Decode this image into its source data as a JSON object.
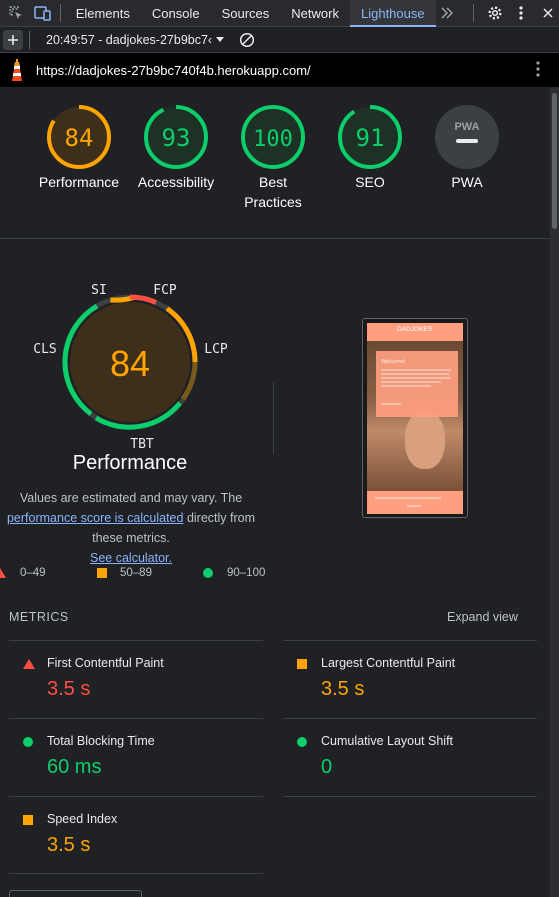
{
  "devtools": {
    "tabs": [
      {
        "label": "Elements",
        "active": false
      },
      {
        "label": "Console",
        "active": false
      },
      {
        "label": "Sources",
        "active": false
      },
      {
        "label": "Network",
        "active": false
      },
      {
        "label": "Lighthouse",
        "active": true
      }
    ],
    "more_tabs_icon": "chevron-double-right-icon",
    "settings_icon": "gear-icon",
    "menu_icon": "vertical-dots-icon",
    "report_selector": "20:49:57 - dadjokes-27b9bc7‹",
    "url": "https://dadjokes-27b9bc740f4b.herokuapp.com/"
  },
  "gauges": [
    {
      "label": "Performance",
      "score": "84",
      "value": 84,
      "color": "#ffa400"
    },
    {
      "label": "Accessibility",
      "score": "93",
      "value": 93,
      "color": "#0cce6b"
    },
    {
      "label": "Best Practices",
      "score": "100",
      "value": 100,
      "color": "#0cce6b"
    },
    {
      "label": "SEO",
      "score": "91",
      "value": 91,
      "color": "#0cce6b"
    },
    {
      "label": "PWA",
      "score": "PWA",
      "color": "#9aa0a6"
    }
  ],
  "performance": {
    "score": "84",
    "title": "Performance",
    "segments": {
      "si": "SI",
      "fcp": "FCP",
      "lcp": "LCP",
      "tbt": "TBT",
      "cls": "CLS"
    },
    "desc_before": "Values are estimated and may vary. The ",
    "desc_link": "performance score is calculated",
    "desc_middle": " directly from these metrics. ",
    "desc_link2": "See calculator."
  },
  "legend": [
    {
      "range": "0–49",
      "color": "#ff4e42",
      "shape": "triangle"
    },
    {
      "range": "50–89",
      "color": "#ffa400",
      "shape": "square"
    },
    {
      "range": "90–100",
      "color": "#0cce6b",
      "shape": "circle"
    }
  ],
  "screenshot": {
    "app_name": "DADJOKES",
    "welcome": "Welcome!"
  },
  "metrics": {
    "header": "METRICS",
    "expand": "Expand view",
    "items": [
      {
        "name": "First Contentful Paint",
        "value": "3.5 s",
        "color": "#ff4e42",
        "shape": "triangle"
      },
      {
        "name": "Largest Contentful Paint",
        "value": "3.5 s",
        "color": "#ffa400",
        "shape": "square"
      },
      {
        "name": "Total Blocking Time",
        "value": "60 ms",
        "color": "#0cce6b",
        "shape": "circle"
      },
      {
        "name": "Cumulative Layout Shift",
        "value": "0",
        "color": "#0cce6b",
        "shape": "circle"
      },
      {
        "name": "Speed Index",
        "value": "3.5 s",
        "color": "#ffa400",
        "shape": "square"
      }
    ]
  }
}
